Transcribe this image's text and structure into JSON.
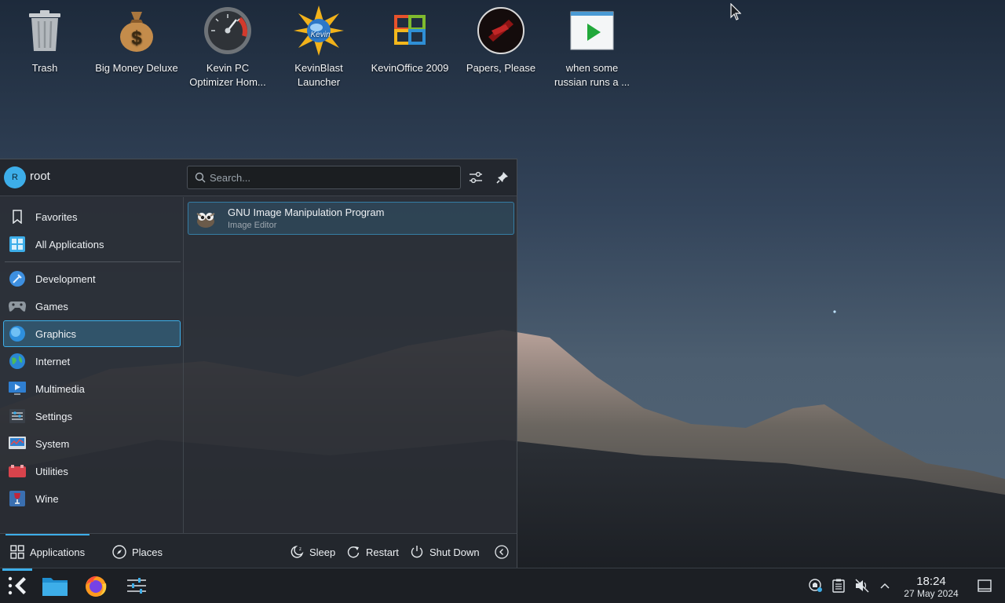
{
  "desktop": {
    "icons": [
      {
        "label": "Trash",
        "icon": "trash-icon"
      },
      {
        "label": "Big Money Deluxe",
        "icon": "money-bag-icon"
      },
      {
        "label": "Kevin PC Optimizer Hom...",
        "icon": "speedometer-icon"
      },
      {
        "label": "KevinBlast Launcher",
        "icon": "kevinblast-logo-icon"
      },
      {
        "label": "KevinOffice 2009",
        "icon": "office-logo-icon"
      },
      {
        "label": "Papers, Please",
        "icon": "papers-please-icon"
      },
      {
        "label": "when some russian runs a ...",
        "icon": "video-play-icon"
      }
    ]
  },
  "launcher": {
    "user": {
      "initial": "R",
      "name": "root"
    },
    "search": {
      "placeholder": "Search..."
    },
    "sidebar": {
      "items": [
        {
          "label": "Favorites",
          "icon": "bookmark-icon"
        },
        {
          "label": "All Applications",
          "icon": "grid-apps-icon"
        },
        {
          "label": "Development",
          "icon": "development-icon"
        },
        {
          "label": "Games",
          "icon": "gamepad-icon"
        },
        {
          "label": "Graphics",
          "icon": "graphics-icon"
        },
        {
          "label": "Internet",
          "icon": "globe-icon"
        },
        {
          "label": "Multimedia",
          "icon": "multimedia-icon"
        },
        {
          "label": "Settings",
          "icon": "settings-icon"
        },
        {
          "label": "System",
          "icon": "system-icon"
        },
        {
          "label": "Utilities",
          "icon": "utilities-icon"
        },
        {
          "label": "Wine",
          "icon": "wine-icon"
        }
      ],
      "selected": "Graphics"
    },
    "results": [
      {
        "title": "GNU Image Manipulation Program",
        "subtitle": "Image Editor",
        "icon": "gimp-icon"
      }
    ],
    "footer": {
      "tabs": [
        {
          "label": "Applications",
          "icon": "applications-grid-icon"
        },
        {
          "label": "Places",
          "icon": "compass-icon"
        }
      ],
      "active_tab": "Applications",
      "power": [
        {
          "label": "Sleep",
          "icon": "sleep-icon"
        },
        {
          "label": "Restart",
          "icon": "restart-icon"
        },
        {
          "label": "Shut Down",
          "icon": "power-icon"
        }
      ]
    }
  },
  "taskbar": {
    "apps": [
      {
        "name": "Application Launcher",
        "icon": "kde-launcher-icon"
      },
      {
        "name": "Files",
        "icon": "folder-icon"
      },
      {
        "name": "Firefox",
        "icon": "firefox-icon"
      },
      {
        "name": "System Settings",
        "icon": "sliders-icon"
      }
    ],
    "tray": [
      {
        "name": "network",
        "icon": "network-icon"
      },
      {
        "name": "clipboard",
        "icon": "clipboard-icon"
      },
      {
        "name": "volume",
        "icon": "volume-muted-icon"
      },
      {
        "name": "expand",
        "icon": "chevron-up-icon"
      }
    ],
    "clock": {
      "time": "18:24",
      "date": "27 May 2024"
    }
  },
  "colors": {
    "accent": "#3daee9",
    "panel": "#1c1f24",
    "launcher_bg": "#2a2e34"
  }
}
